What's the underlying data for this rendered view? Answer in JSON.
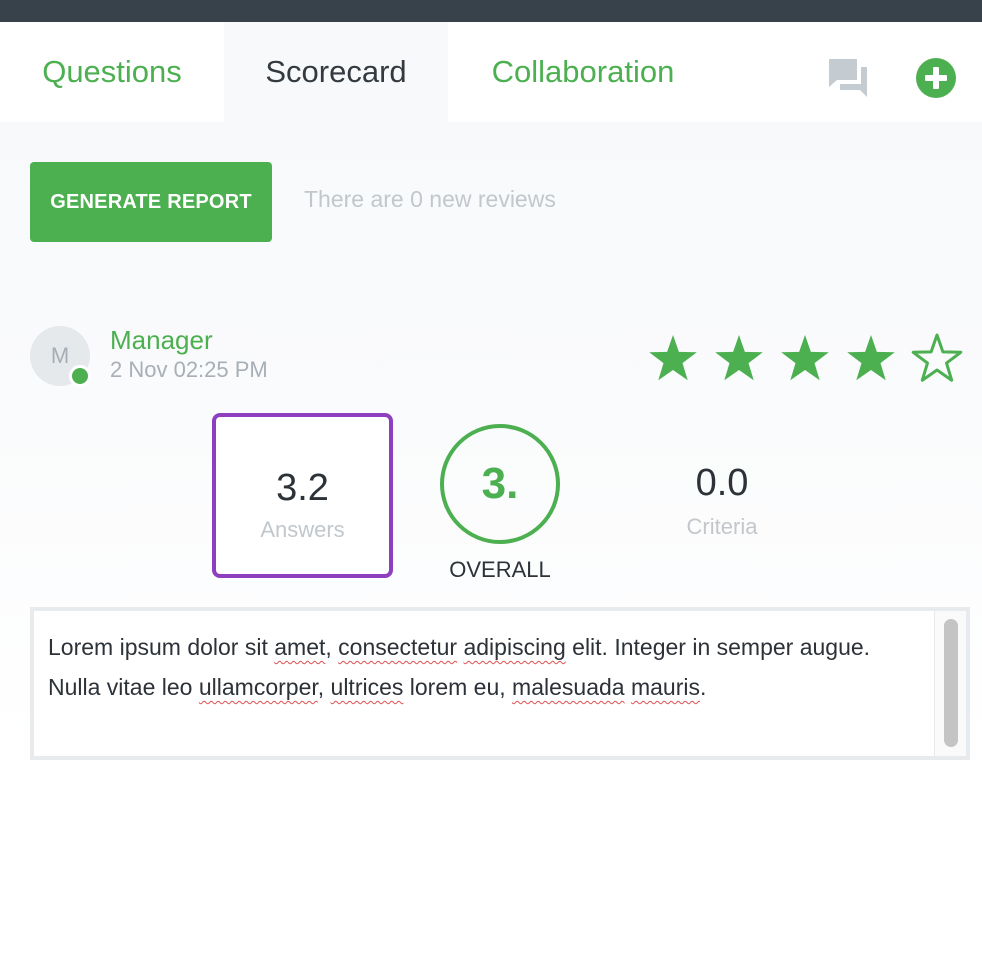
{
  "tabs": {
    "questions": "Questions",
    "scorecard": "Scorecard",
    "collaboration": "Collaboration"
  },
  "icons": {
    "chat": "chat-bubbles-icon",
    "add": "plus-circle-icon"
  },
  "actions": {
    "generate_report": "GENERATE REPORT",
    "reviews_note": "There are 0 new reviews"
  },
  "review": {
    "avatar_initial": "M",
    "reviewer": "Manager",
    "date": "2 Nov 02:25 PM",
    "rating": 4,
    "rating_max": 5,
    "answers_score": "3.2",
    "answers_label": "Answers",
    "overall_score": "3.",
    "overall_label": "OVERALL",
    "criteria_score": "0.0",
    "criteria_label": "Criteria",
    "comment": {
      "w1": "Lorem ipsum dolor sit ",
      "s1": "amet",
      "w2": ", ",
      "s2": "consectetur",
      "w3": " ",
      "s3": "adipiscing",
      "w4": " elit. Integer in semper augue. Nulla vitae leo ",
      "s4": "ullamcorper",
      "w5": ", ",
      "s5": "ultrices",
      "w6": " lorem eu, ",
      "s6": "malesuada",
      "w7": " ",
      "s7": "mauris",
      "w8": "."
    }
  },
  "colors": {
    "accent": "#4caf50",
    "highlight": "#8e3fc0",
    "topbar": "#37424b",
    "muted_text": "#c2c7cc"
  }
}
